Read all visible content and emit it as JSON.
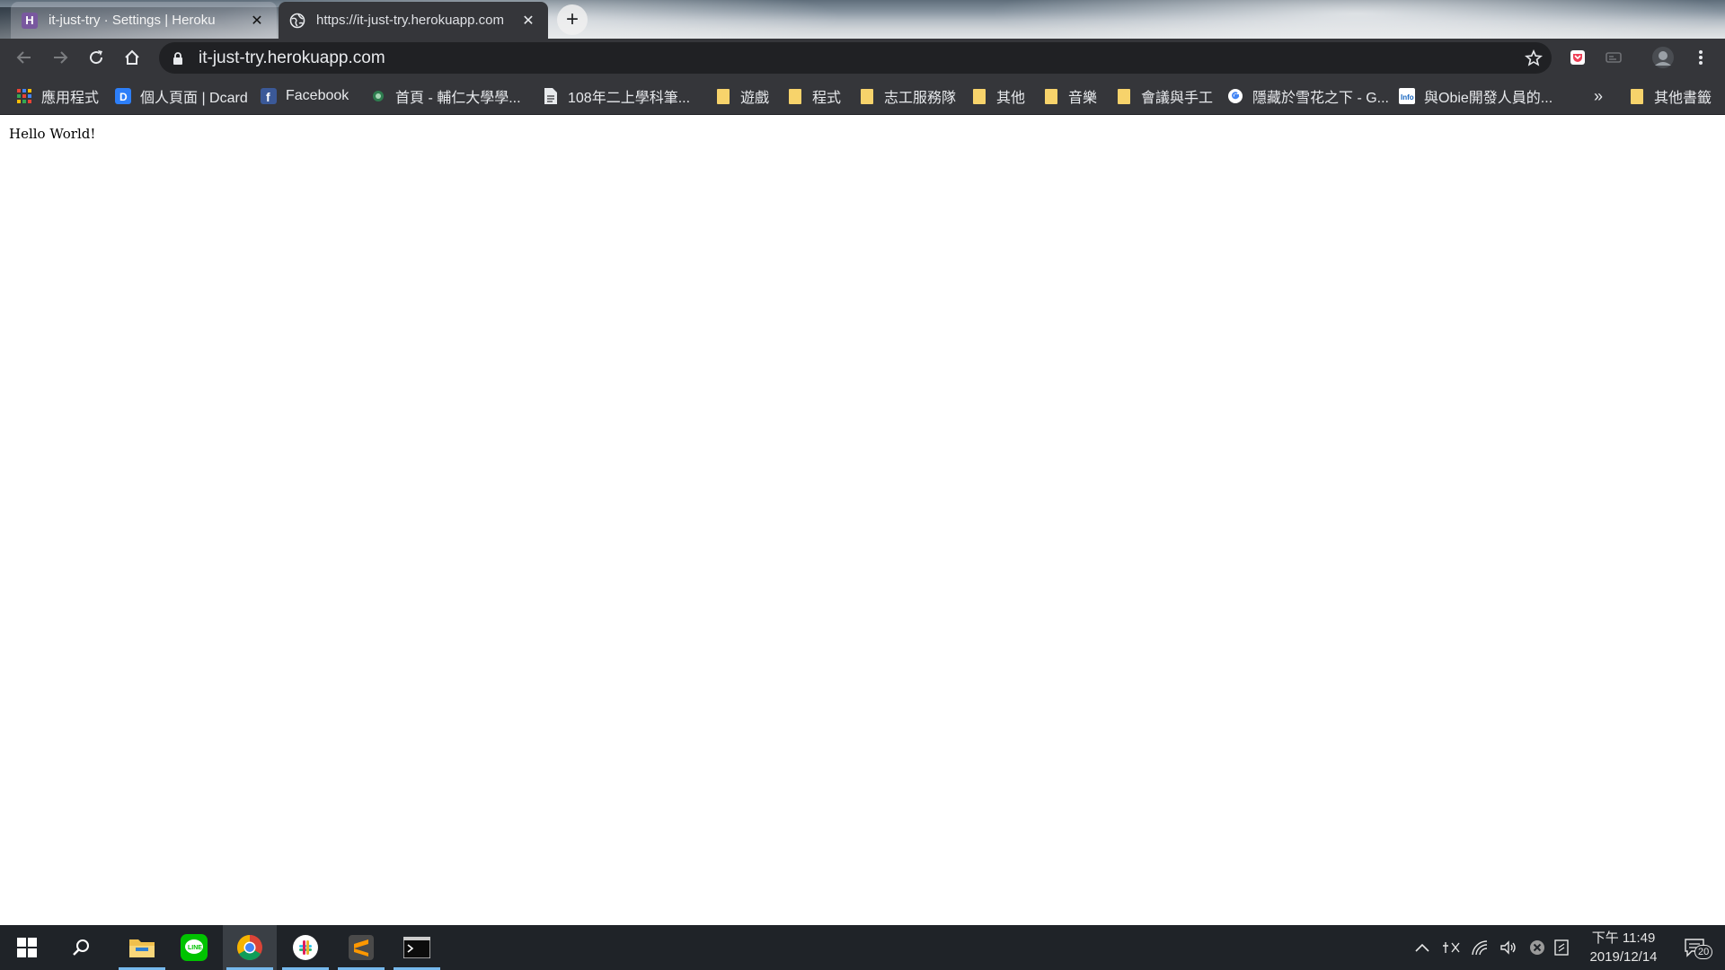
{
  "browser": {
    "tabs": [
      {
        "title": "it-just-try · Settings | Heroku",
        "favicon_letter": "H",
        "active": false
      },
      {
        "title": "https://it-just-try.herokuapp.com",
        "active": true
      }
    ],
    "new_tab_symbol": "+",
    "address_bar": {
      "url": "it-just-try.herokuapp.com"
    }
  },
  "bookmarks": {
    "items": [
      {
        "label": "應用程式",
        "icon": "apps-grid-icon"
      },
      {
        "label": "個人頁面 | Dcard",
        "icon": "dcard-icon"
      },
      {
        "label": "Facebook",
        "icon": "facebook-icon"
      },
      {
        "label": "首頁 - 輔仁大學學...",
        "icon": "site-icon"
      },
      {
        "label": "108年二上學科筆...",
        "icon": "document-icon"
      },
      {
        "label": "遊戲",
        "icon": "folder-icon"
      },
      {
        "label": "程式",
        "icon": "folder-icon"
      },
      {
        "label": "志工服務隊",
        "icon": "folder-icon"
      },
      {
        "label": "其他",
        "icon": "folder-icon"
      },
      {
        "label": "音樂",
        "icon": "folder-icon"
      },
      {
        "label": "會議與手工",
        "icon": "folder-icon"
      },
      {
        "label": "隱藏於雪花之下 - G...",
        "icon": "google-icon"
      },
      {
        "label": "與Obie開發人員的...",
        "icon": "info-icon"
      }
    ],
    "overflow_symbol": "»",
    "other_bookmarks": "其他書籤"
  },
  "page": {
    "text": "Hello World!"
  },
  "taskbar": {
    "apps": [
      "start-icon",
      "search-icon",
      "file-explorer-icon",
      "line-icon",
      "chrome-icon",
      "slack-icon",
      "sublime-text-icon",
      "terminal-icon"
    ],
    "clock": {
      "time": "下午 11:49",
      "date": "2019/12/14"
    },
    "notification_count": "20"
  },
  "colors": {
    "accent": "#76b9ed",
    "toolbar": "#35363a",
    "omnibox": "#202124",
    "folder": "#f7d36b"
  }
}
